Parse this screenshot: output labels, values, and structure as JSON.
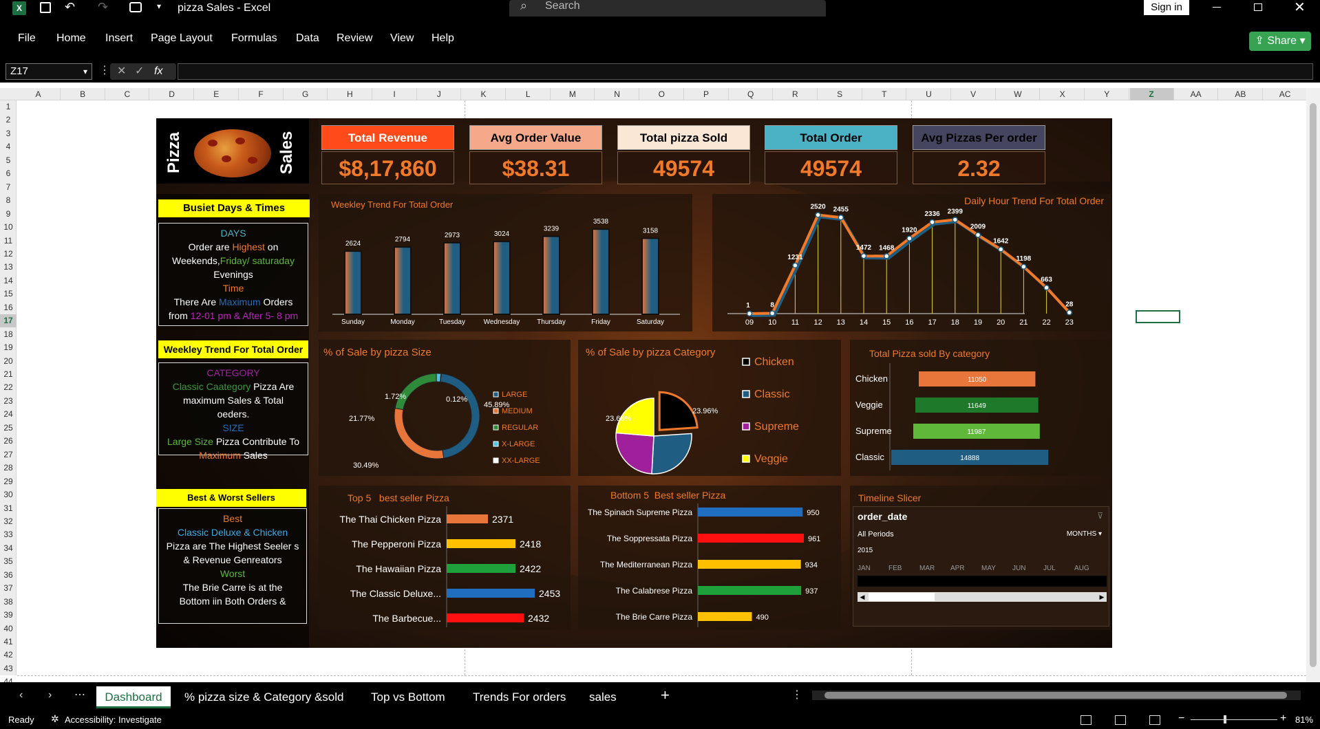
{
  "app": {
    "title": "pizza  Sales  -  Excel",
    "search": "Search",
    "sign_in": "Sign in",
    "share": "Share"
  },
  "menu": [
    "File",
    "Home",
    "Insert",
    "Page Layout",
    "Formulas",
    "Data",
    "Review",
    "View",
    "Help"
  ],
  "formula": {
    "name_box": "Z17",
    "fx": "fx",
    "value": ""
  },
  "columns": [
    "A",
    "B",
    "C",
    "D",
    "E",
    "F",
    "G",
    "H",
    "I",
    "J",
    "K",
    "L",
    "M",
    "N",
    "O",
    "P",
    "Q",
    "R",
    "S",
    "T",
    "U",
    "V",
    "W",
    "X",
    "Y",
    "Z",
    "AA",
    "AB",
    "AC"
  ],
  "rows": [
    "1",
    "2",
    "3",
    "4",
    "5",
    "6",
    "7",
    "8",
    "9",
    "10",
    "11",
    "12",
    "13",
    "14",
    "15",
    "16",
    "17",
    "18",
    "19",
    "20",
    "21",
    "22",
    "23",
    "24",
    "25",
    "26",
    "27",
    "28",
    "29",
    "30",
    "31",
    "32",
    "33",
    "34",
    "35",
    "36",
    "37",
    "38",
    "39",
    "40",
    "41",
    "42",
    "43",
    "44"
  ],
  "dashboard": {
    "logo_left": "Pizza",
    "logo_right": "Sales",
    "kpis": [
      {
        "title": "Total Revenue",
        "value": "$8,17,860",
        "color": "#ff4a1a"
      },
      {
        "title": "Avg Order Value",
        "value": "$38.31",
        "color": "#f5a98a"
      },
      {
        "title": "Total pizza Sold",
        "value": "49574",
        "color": "#fbe7d6"
      },
      {
        "title": "Total Order",
        "value": "49574",
        "color": "#4bb1c4"
      },
      {
        "title": "Avg Pizzas Per order",
        "value": "2.32",
        "color": "#454560"
      }
    ],
    "insight1": {
      "header": "Busiet Days & Times",
      "l1": "DAYS",
      "l2a": "Order are ",
      "l2b": "Highest",
      "l2c": " on",
      "l3a": "Weekends,",
      "l3b": "Friday/ saturaday",
      "l4": "Evenings",
      "l5": "Time",
      "l6a": "There Are ",
      "l6b": "Maximum",
      "l6c": " Orders",
      "l7a": "from ",
      "l7b": "12-01 pm & After 5- 8 pm"
    },
    "insight2": {
      "header": "Weekley  Trend For Total Order",
      "l1": "CATEGORY",
      "l2a": "Classic Caategory",
      "l2b": " Pizza Are",
      "l3": "maximum Sales & Total",
      "l4": "oeders.",
      "l5": "SIZE",
      "l6a": "Large Size",
      "l6b": " Pizza Contribute To",
      "l7a": "Maximum",
      "l7b": " Sales"
    },
    "insight3": {
      "header": "Best & Worst Sellers",
      "l1": "Best",
      "l2": "Classic Deluxe & Chicken",
      "l3": "Pizza are The Highest Seeler s",
      "l4": "& Revenue Genreators",
      "l5": "Worst",
      "l6": "The Brie Carre is at the",
      "l7": "Bottom iin Both Orders &"
    },
    "timeline": {
      "title": "Timeline Slicer",
      "field": "order_date",
      "periods": "All Periods",
      "unit": "MONTHS",
      "year": "2015",
      "months": [
        "JAN",
        "FEB",
        "MAR",
        "APR",
        "MAY",
        "JUN",
        "JUL",
        "AUG"
      ]
    }
  },
  "chart_data": [
    {
      "type": "bar",
      "title": "Weekley  Trend For Total Order",
      "categories": [
        "Sunday",
        "Monday",
        "Tuesday",
        "Wednesday",
        "Thursday",
        "Friday",
        "Saturday"
      ],
      "values": [
        2624,
        2794,
        2973,
        3024,
        3239,
        3538,
        3158
      ]
    },
    {
      "type": "line",
      "title": "Daily Hour Trend For Total Order",
      "x": [
        "09",
        "10",
        "11",
        "12",
        "13",
        "14",
        "15",
        "16",
        "17",
        "18",
        "19",
        "20",
        "21",
        "22",
        "23"
      ],
      "values": [
        1,
        8,
        1231,
        2520,
        2455,
        1472,
        1468,
        1920,
        2336,
        2399,
        2009,
        1642,
        1198,
        663,
        28
      ]
    },
    {
      "type": "pie",
      "title": "% of Sale by pizza Size",
      "labels": [
        "LARGE",
        "MEDIUM",
        "REGULAR",
        "X-LARGE",
        "XX-LARGE"
      ],
      "values": [
        45.89,
        30.49,
        21.77,
        1.72,
        0.12
      ],
      "value_labels": [
        "45.89%",
        "30.49%",
        "21.77%",
        "1.72%",
        "0.12%"
      ],
      "colors": [
        "#1f5e82",
        "#e8763a",
        "#2f8a3a",
        "#4fc3e8",
        "#ffffff"
      ]
    },
    {
      "type": "pie",
      "title": "% of Sale by pizza Category",
      "labels": [
        "Chicken",
        "Classic",
        "Supreme",
        "Veggie"
      ],
      "values": [
        23.96,
        26.91,
        25.46,
        23.68
      ],
      "value_labels": [
        "23.96%",
        "26.91%",
        "25.46%",
        "23.68%"
      ],
      "colors": [
        "#000000",
        "#1f5e82",
        "#a01f9a",
        "#ffff00"
      ]
    },
    {
      "type": "bar",
      "title": "Total Pizza sold By category",
      "categories": [
        "Chicken",
        "Veggie",
        "Supreme",
        "Classic"
      ],
      "values": [
        11050,
        11649,
        11987,
        14888
      ],
      "colors": [
        "#e8763a",
        "#1e7a2a",
        "#5fb83a",
        "#1f5e82"
      ]
    },
    {
      "type": "bar",
      "title": "Top 5   best seller Pizza",
      "categories": [
        "The Thai Chicken Pizza",
        "The Pepperoni Pizza",
        "The Hawaiian Pizza",
        "The Classic Deluxe...",
        "The Barbecue..."
      ],
      "values": [
        2371,
        2418,
        2422,
        2453,
        2432
      ],
      "colors": [
        "#e8763a",
        "#ffc000",
        "#1ea03a",
        "#1f6ec0",
        "#ff1010"
      ]
    },
    {
      "type": "bar",
      "title": "Bottom 5  Best seller Pizza",
      "categories": [
        "The Spinach Supreme Pizza",
        "The Soppressata Pizza",
        "The Mediterranean Pizza",
        "The Calabrese Pizza",
        "The Brie Carre Pizza"
      ],
      "values": [
        950,
        961,
        934,
        937,
        490
      ],
      "colors": [
        "#1f6ec0",
        "#ff1010",
        "#ffc000",
        "#1ea03a",
        "#ffc000"
      ]
    }
  ],
  "sheet_tabs": [
    "Dashboard",
    "% pizza size & Category &sold",
    "Top vs Bottom",
    "Trends For orders",
    "sales"
  ],
  "status": {
    "ready": "Ready",
    "accessibility": "Accessibility: Investigate",
    "zoom": "81%"
  }
}
